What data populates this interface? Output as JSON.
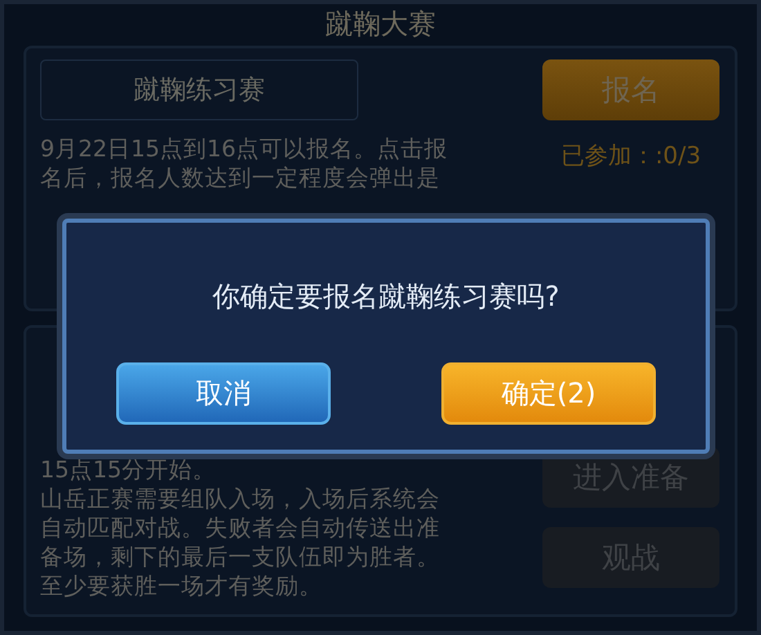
{
  "window": {
    "title": "蹴鞠大赛"
  },
  "events": [
    {
      "name": "蹴鞠练习赛",
      "button": "报名",
      "joined": "已参加：:0/3",
      "description": [
        "9月22日15点到16点可以报名。点击报",
        "名后，报名人数达到一定程度会弹出是"
      ]
    },
    {
      "description": [
        "15点15分开始。",
        "山岳正赛需要组队入场，入场后系统会",
        "自动匹配对战。失败者会自动传送出准",
        "备场，剩下的最后一支队伍即为胜者。",
        "至少要获胜一场才有奖励。"
      ],
      "buttons": [
        "进入准备",
        "观战"
      ]
    }
  ],
  "dialog": {
    "message": "你确定要报名蹴鞠练习赛吗?",
    "buttons": [
      {
        "label": "取消",
        "kind": "cancel"
      },
      {
        "label": "确定(2)",
        "kind": "confirm"
      }
    ]
  }
}
